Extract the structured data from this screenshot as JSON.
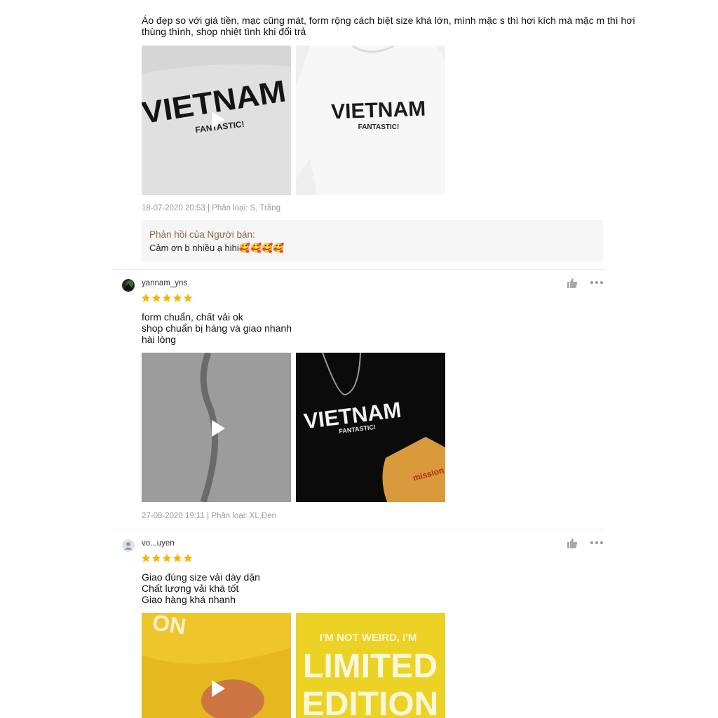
{
  "reviews": [
    {
      "text": "Áo đẹp so với giá tiền, mạc cũng mát, form rộng cách biệt size khá lớn, mình mặc s thì hơi kích mà mặc m thì hơi\nthùng thình, shop nhiệt tình khi đổi trả",
      "media": [
        {
          "kind": "video",
          "print_text": "VIETNAM",
          "sub_text": "FANTASTIC!",
          "shirt_color": "#d9d9d9"
        },
        {
          "kind": "image",
          "print_text": "VIETNAM",
          "sub_text": "FANTASTIC!",
          "shirt_color": "#f4f4f4"
        }
      ],
      "meta": "18-07-2020 20:53 | Phân loại: S, Trắng",
      "seller_reply": {
        "title": "Phản hồi của Người bán:",
        "body": "Cảm ơn b nhiều ạ hihi🥰🥰🥰🥰"
      }
    },
    {
      "username": "yannam_yns",
      "rating": 5,
      "text": "form chuẩn, chất vải ok\nshop chuẩn bị hàng và giao nhanh\nhài lòng",
      "media": [
        {
          "kind": "video",
          "shirt_color": "#9a9a9a"
        },
        {
          "kind": "image",
          "print_text": "VIETNAM",
          "sub_text": "FANTASTIC!",
          "package_text": "mission",
          "shirt_color": "#0d0d0d"
        }
      ],
      "meta": "27-08-2020 19:11 | Phân loại: XL,Đen"
    },
    {
      "username": "vo...uyen",
      "rating": 5,
      "text": "Giao đúng size vải dày dặn\nChất lượng vải khá tốt\nGiao hàng khá nhanh",
      "media": [
        {
          "kind": "video",
          "print_text": "ON",
          "shirt_color": "#f2cc2a"
        },
        {
          "kind": "image",
          "print_text": "I'M NOT WEIRD, I'M",
          "big_text_1": "LIMITED",
          "big_text_2": "EDITION",
          "shirt_color": "#f0d624"
        }
      ]
    }
  ],
  "colors": {
    "star": "#f6b600",
    "reply_title": "#8a6a4a",
    "meta": "#9b9b9b"
  },
  "icons": {
    "like": "thumbs-up-icon",
    "more": "more-dots-icon",
    "play": "play-icon",
    "star": "star-icon"
  }
}
